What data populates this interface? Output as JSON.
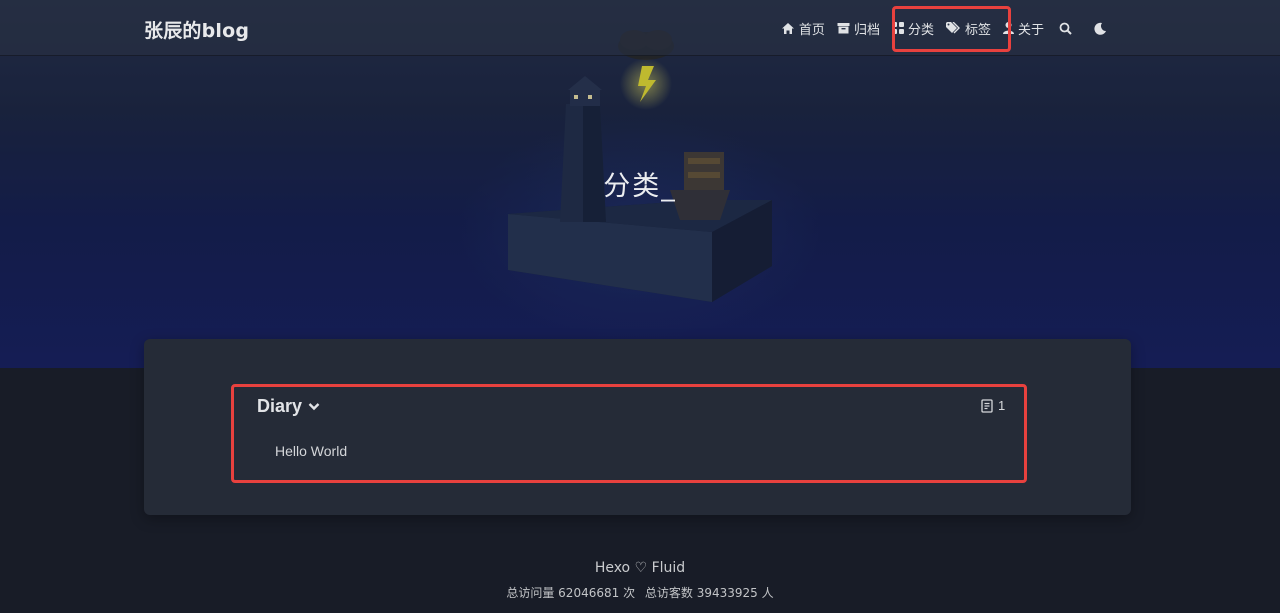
{
  "site": {
    "brand": "张辰的blog"
  },
  "nav": {
    "items": [
      {
        "label": "首页",
        "icon": "home-icon"
      },
      {
        "label": "归档",
        "icon": "archive-icon"
      },
      {
        "label": "分类",
        "icon": "categories-icon"
      },
      {
        "label": "标签",
        "icon": "tags-icon"
      },
      {
        "label": "关于",
        "icon": "user-icon"
      }
    ],
    "search_icon": "search-icon",
    "theme_icon": "moon-icon"
  },
  "hero": {
    "title": "分类_"
  },
  "categories": [
    {
      "name": "Diary",
      "count": "1",
      "posts": [
        "Hello World"
      ]
    }
  ],
  "footer": {
    "powered": "Hexo ♡ Fluid",
    "pv_label": "总访问量 62046681 次",
    "uv_label": "总访客数 39433925 人"
  },
  "colors": {
    "highlight": "#e8413e",
    "background": "#181c27",
    "card": "#252b37"
  }
}
